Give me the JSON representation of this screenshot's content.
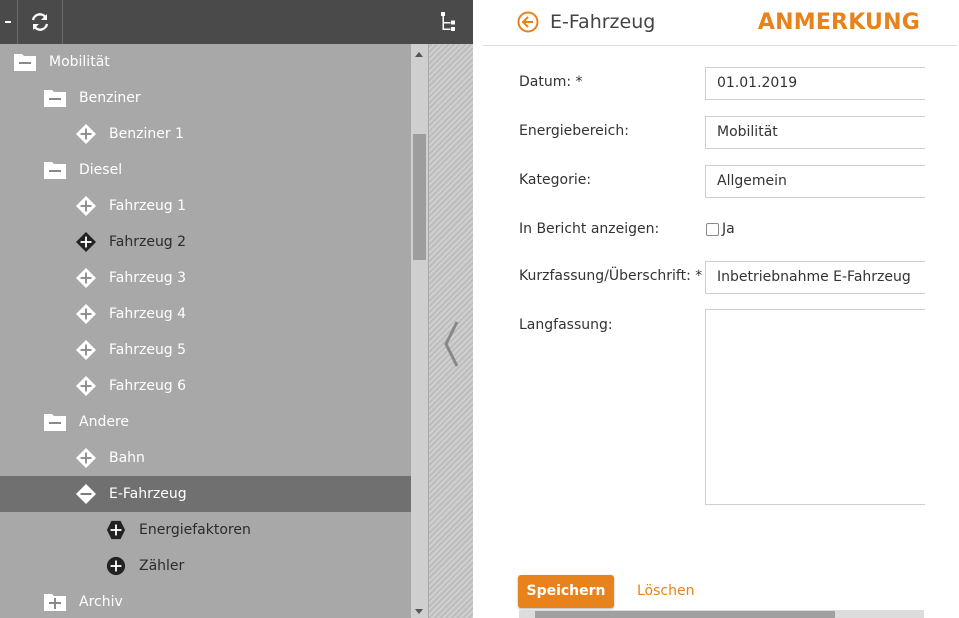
{
  "tree": {
    "items": [
      {
        "label": "Mobilität",
        "icon": "folder-minus-icon"
      },
      {
        "label": "Benziner",
        "icon": "folder-minus-icon"
      },
      {
        "label": "Benziner 1",
        "icon": "diamond-plus-icon"
      },
      {
        "label": "Diesel",
        "icon": "folder-minus-icon"
      },
      {
        "label": "Fahrzeug 1",
        "icon": "diamond-plus-icon"
      },
      {
        "label": "Fahrzeug 2",
        "icon": "diamond-plus-icon"
      },
      {
        "label": "Fahrzeug 3",
        "icon": "diamond-plus-icon"
      },
      {
        "label": "Fahrzeug 4",
        "icon": "diamond-plus-icon"
      },
      {
        "label": "Fahrzeug 5",
        "icon": "diamond-plus-icon"
      },
      {
        "label": "Fahrzeug 6",
        "icon": "diamond-plus-icon"
      },
      {
        "label": "Andere",
        "icon": "folder-minus-icon"
      },
      {
        "label": "Bahn",
        "icon": "diamond-plus-icon"
      },
      {
        "label": "E-Fahrzeug",
        "icon": "diamond-minus-icon"
      },
      {
        "label": "Energiefaktoren",
        "icon": "hexagon-plus-icon"
      },
      {
        "label": "Zähler",
        "icon": "circle-plus-icon"
      },
      {
        "label": "Archiv",
        "icon": "folder-plus-icon"
      }
    ]
  },
  "form": {
    "header_title": "E-Fahrzeug",
    "header_badge": "ANMERKUNG",
    "fields": {
      "datum_label": "Datum: *",
      "datum_value": "01.01.2019",
      "energiebereich_label": "Energiebereich:",
      "energiebereich_value": "Mobilität",
      "kategorie_label": "Kategorie:",
      "kategorie_value": "Allgemein",
      "bericht_label": "In Bericht anzeigen:",
      "bericht_option": "Ja",
      "kurz_label": "Kurzfassung/Überschrift: *",
      "kurz_value": "Inbetriebnahme E-Fahrzeug",
      "lang_label": "Langfassung:"
    },
    "save_label": "Speichern",
    "delete_label": "Löschen"
  },
  "colors": {
    "accent": "#e8821c",
    "tree_bg": "#a8a8a8",
    "toolbar_bg": "#4a4a4a",
    "selected_row": "#707070"
  }
}
